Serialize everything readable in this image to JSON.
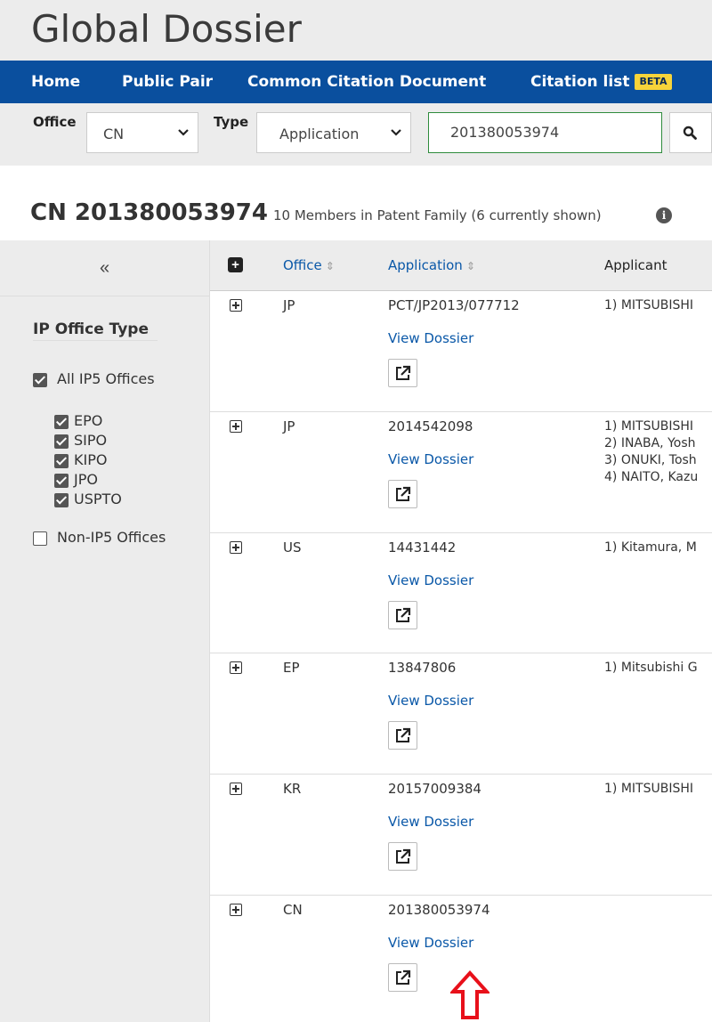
{
  "app": {
    "title": "Global Dossier"
  },
  "nav": {
    "home": "Home",
    "public_pair": "Public Pair",
    "common_citation": "Common Citation Document",
    "citation_list": "Citation list",
    "beta_badge": "BETA"
  },
  "search": {
    "office_label": "Office",
    "office_value": "CN",
    "type_label": "Type",
    "type_value": "Application",
    "number_value": "201380053974"
  },
  "page": {
    "title": "CN 201380053974",
    "subtitle": "10 Members in Patent Family (6 currently shown)"
  },
  "sidebar": {
    "collapse": "«",
    "filter_title": "IP Office Type",
    "all_ip5": "All IP5 Offices",
    "offices": [
      "EPO",
      "SIPO",
      "KIPO",
      "JPO",
      "USPTO"
    ],
    "non_ip5": "Non-IP5 Offices"
  },
  "table": {
    "headers": {
      "office": "Office",
      "application": "Application",
      "applicant": "Applicant"
    },
    "view_dossier": "View Dossier",
    "rows": [
      {
        "office": "JP",
        "application": "PCT/JP2013/077712",
        "applicants": [
          "1) MITSUBISHI"
        ]
      },
      {
        "office": "JP",
        "application": "2014542098",
        "applicants": [
          "1) MITSUBISHI",
          "2) INABA, Yosh",
          "3) ONUKI, Tosh",
          "4) NAITO, Kazu"
        ]
      },
      {
        "office": "US",
        "application": "14431442",
        "applicants": [
          "1) Kitamura, M"
        ]
      },
      {
        "office": "EP",
        "application": "13847806",
        "applicants": [
          "1) Mitsubishi G"
        ]
      },
      {
        "office": "KR",
        "application": "20157009384",
        "applicants": [
          "1) MITSUBISHI"
        ]
      },
      {
        "office": "CN",
        "application": "201380053974",
        "applicants": []
      }
    ]
  },
  "colors": {
    "nav_bg": "#0a4f9e",
    "beta_bg": "#f7d43a",
    "link": "#0a58a8",
    "arrow": "#e8101a",
    "search_border": "#2e8b3c"
  }
}
